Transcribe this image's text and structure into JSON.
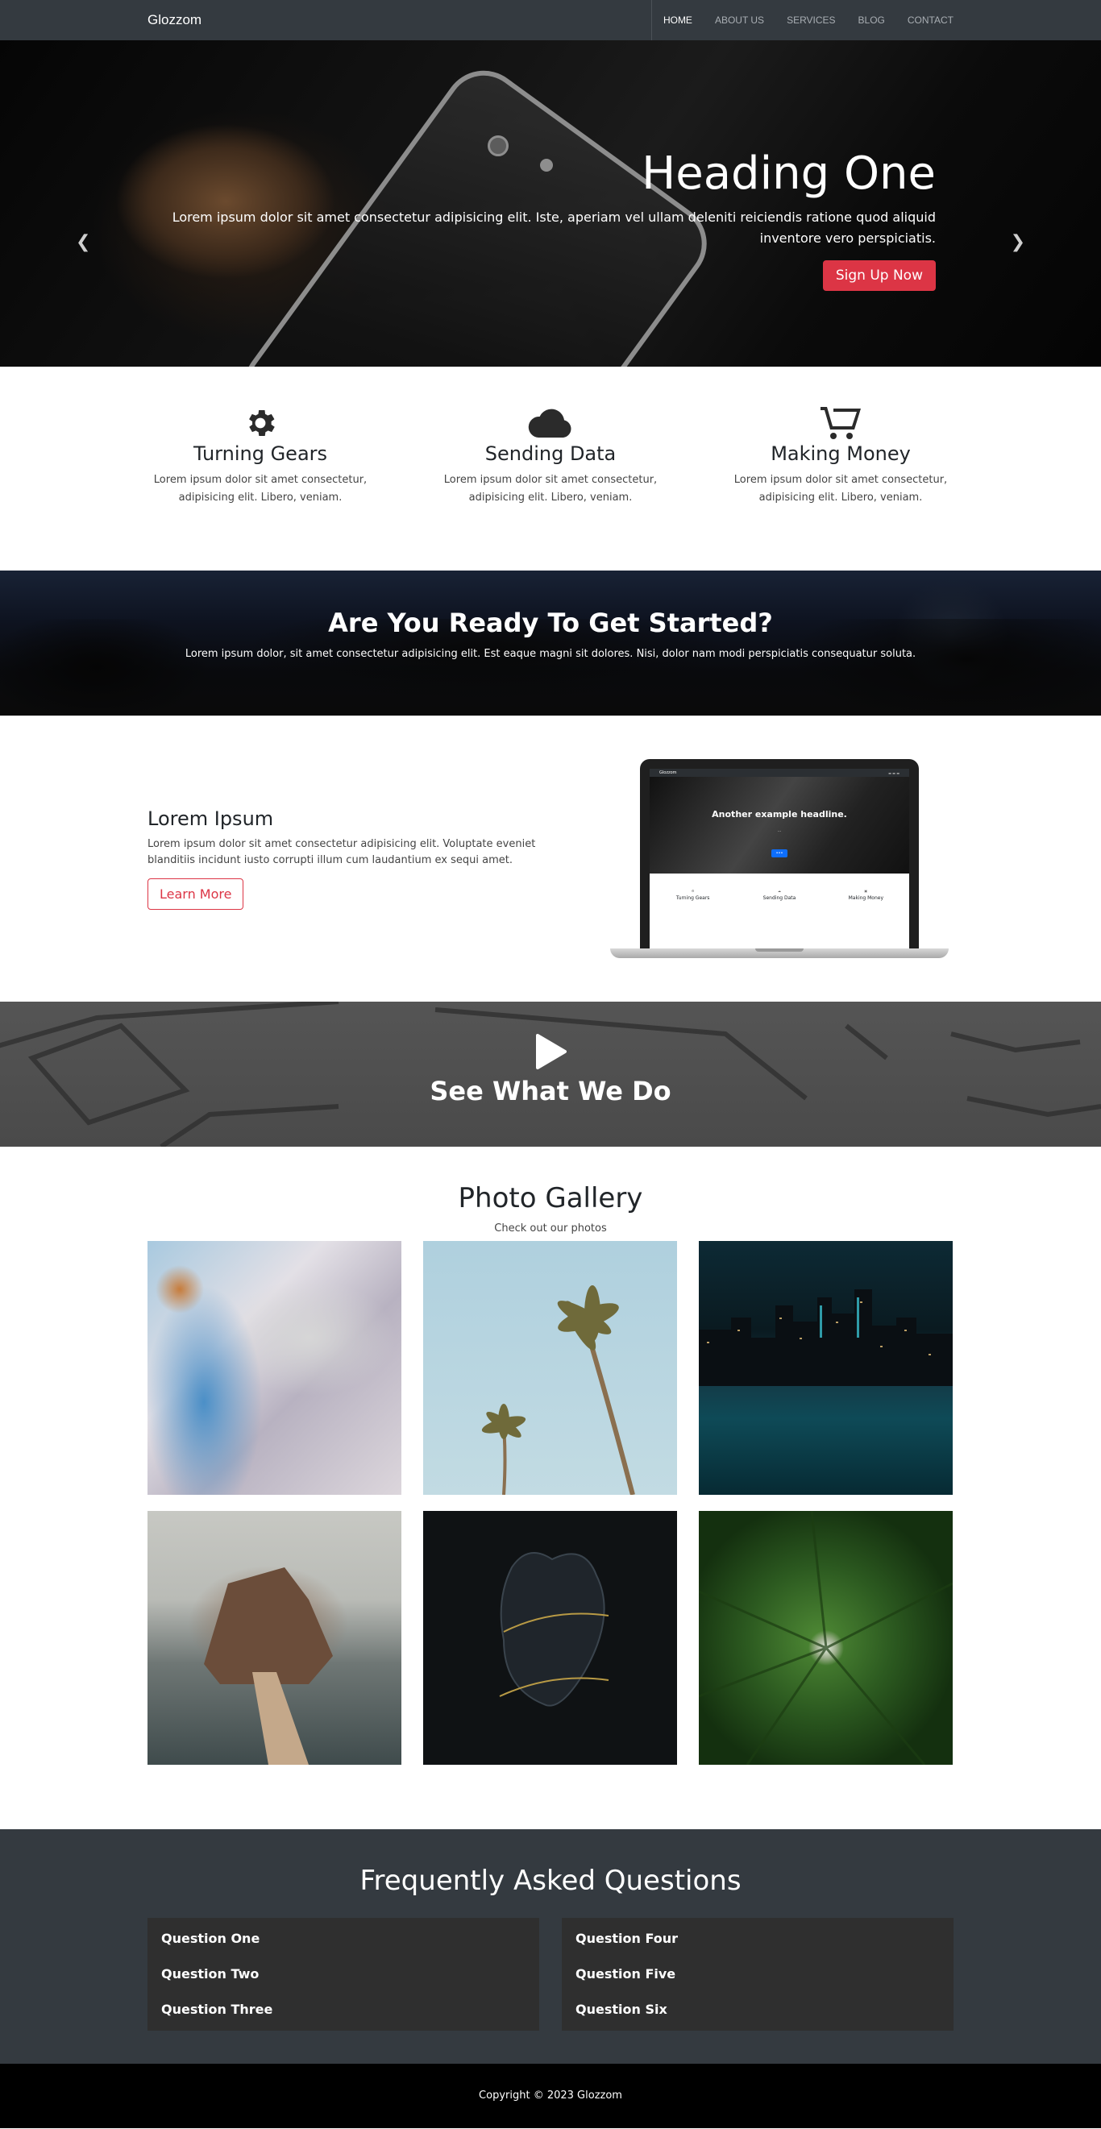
{
  "navbar": {
    "brand": "Glozzom",
    "links": [
      {
        "label": "HOME",
        "active": true
      },
      {
        "label": "ABOUT US",
        "active": false
      },
      {
        "label": "SERVICES",
        "active": false
      },
      {
        "label": "BLOG",
        "active": false
      },
      {
        "label": "CONTACT",
        "active": false
      }
    ]
  },
  "hero": {
    "heading": "Heading One",
    "text": "Lorem ipsum dolor sit amet consectetur adipisicing elit. Iste, aperiam vel ullam deleniti reiciendis ratione quod aliquid inventore vero perspiciatis.",
    "button": "Sign Up Now",
    "prev_icon": "chevron-left-icon",
    "next_icon": "chevron-right-icon",
    "slides_count": 3,
    "active_slide": 1
  },
  "features": [
    {
      "icon": "gear-icon",
      "title": "Turning Gears",
      "text": "Lorem ipsum dolor sit amet consectetur, adipisicing elit. Libero, veniam."
    },
    {
      "icon": "cloud-icon",
      "title": "Sending Data",
      "text": "Lorem ipsum dolor sit amet consectetur, adipisicing elit. Libero, veniam."
    },
    {
      "icon": "cart-plus-icon",
      "title": "Making Money",
      "text": "Lorem ipsum dolor sit amet consectetur, adipisicing elit. Libero, veniam."
    }
  ],
  "cta": {
    "heading": "Are You Ready To Get Started?",
    "text": "Lorem ipsum dolor, sit amet consectetur adipisicing elit. Est eaque magni sit dolores. Nisi, dolor nam modi perspiciatis consequatur soluta."
  },
  "info": {
    "heading": "Lorem Ipsum",
    "text": "Lorem ipsum dolor sit amet consectetur adipisicing elit. Voluptate eveniet blanditiis incidunt iusto corrupti illum cum laudantium ex sequi amet.",
    "button": "Learn More",
    "laptop_screen": {
      "headline": "Another example headline.",
      "features": [
        "Turning Gears",
        "Sending Data",
        "Making Money"
      ]
    }
  },
  "video": {
    "heading": "See What We Do",
    "icon": "play-icon"
  },
  "gallery": {
    "heading": "Photo Gallery",
    "subheading": "Check out our photos",
    "photos": [
      "abstract-paint",
      "palm-trees",
      "city-skyline",
      "sea-rock-path",
      "black-heart",
      "green-leaf-drop"
    ]
  },
  "faq": {
    "heading": "Frequently Asked Questions",
    "left": [
      "Question One",
      "Question Two",
      "Question Three"
    ],
    "right": [
      "Question Four",
      "Question Five",
      "Question Six"
    ]
  },
  "footer": {
    "copyright": "Copyright © 2023 Glozzom"
  },
  "colors": {
    "dark": "#343a40",
    "danger": "#dc3545",
    "footer": "#000000"
  }
}
